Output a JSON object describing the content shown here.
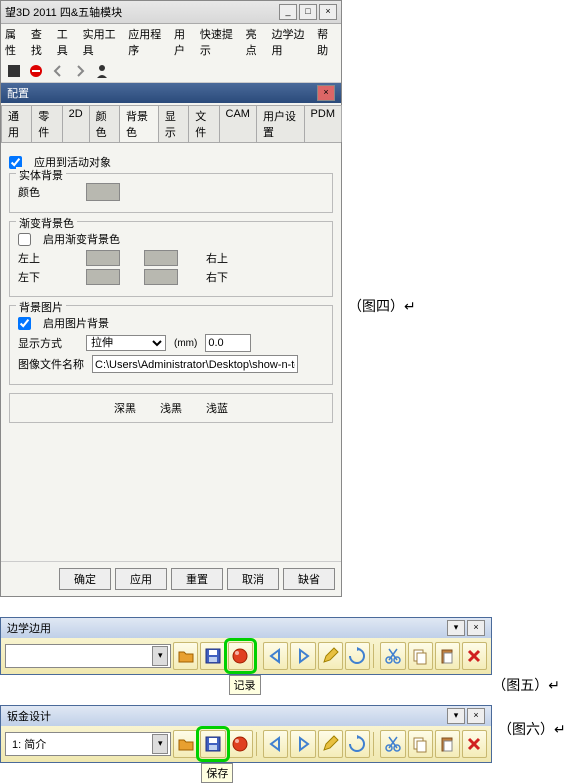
{
  "win1": {
    "title": "望3D 2011 四&五轴模块",
    "menu": [
      "属性",
      "查找",
      "工具",
      "实用工具",
      "应用程序",
      "用户",
      "快速提示",
      "亮点",
      "边学边用",
      "帮助"
    ],
    "dlg_title": "配置",
    "tabs": [
      "通用",
      "零件",
      "2D",
      "颜色",
      "背景色",
      "显示",
      "文件",
      "CAM",
      "用户设置",
      "PDM"
    ],
    "active_tab": 4,
    "chk_apply": "应用到活动对象",
    "grp_solid": {
      "legend": "实体背景",
      "label_color": "颜色"
    },
    "grp_grad": {
      "legend": "渐变背景色",
      "chk_enable": "启用渐变背景色",
      "lbl_tl": "左上",
      "lbl_tr": "右上",
      "lbl_bl": "左下",
      "lbl_br": "右下"
    },
    "grp_img": {
      "legend": "背景图片",
      "chk_enable": "启用图片背景",
      "lbl_mode": "显示方式",
      "mode_val": "拉伸",
      "mm_unit": "(mm)",
      "mm_val": "0.0",
      "lbl_file": "图像文件名称",
      "file_val": "C:\\Users\\Administrator\\Desktop\\show-n-tell制作\\板金"
    },
    "linkrow": [
      "深黑",
      "浅黑",
      "浅蓝"
    ],
    "footer": [
      "确定",
      "应用",
      "重置",
      "取消",
      "缺省"
    ]
  },
  "fig4": "（图四）",
  "fig5": "（图五）",
  "fig6": "（图六）",
  "tool2": {
    "title": "边学边用",
    "combo": "",
    "tooltip": "记录"
  },
  "tool3": {
    "title": "钣金设计",
    "combo": "1: 简介",
    "tooltip": "保存"
  },
  "arrow": "↵"
}
